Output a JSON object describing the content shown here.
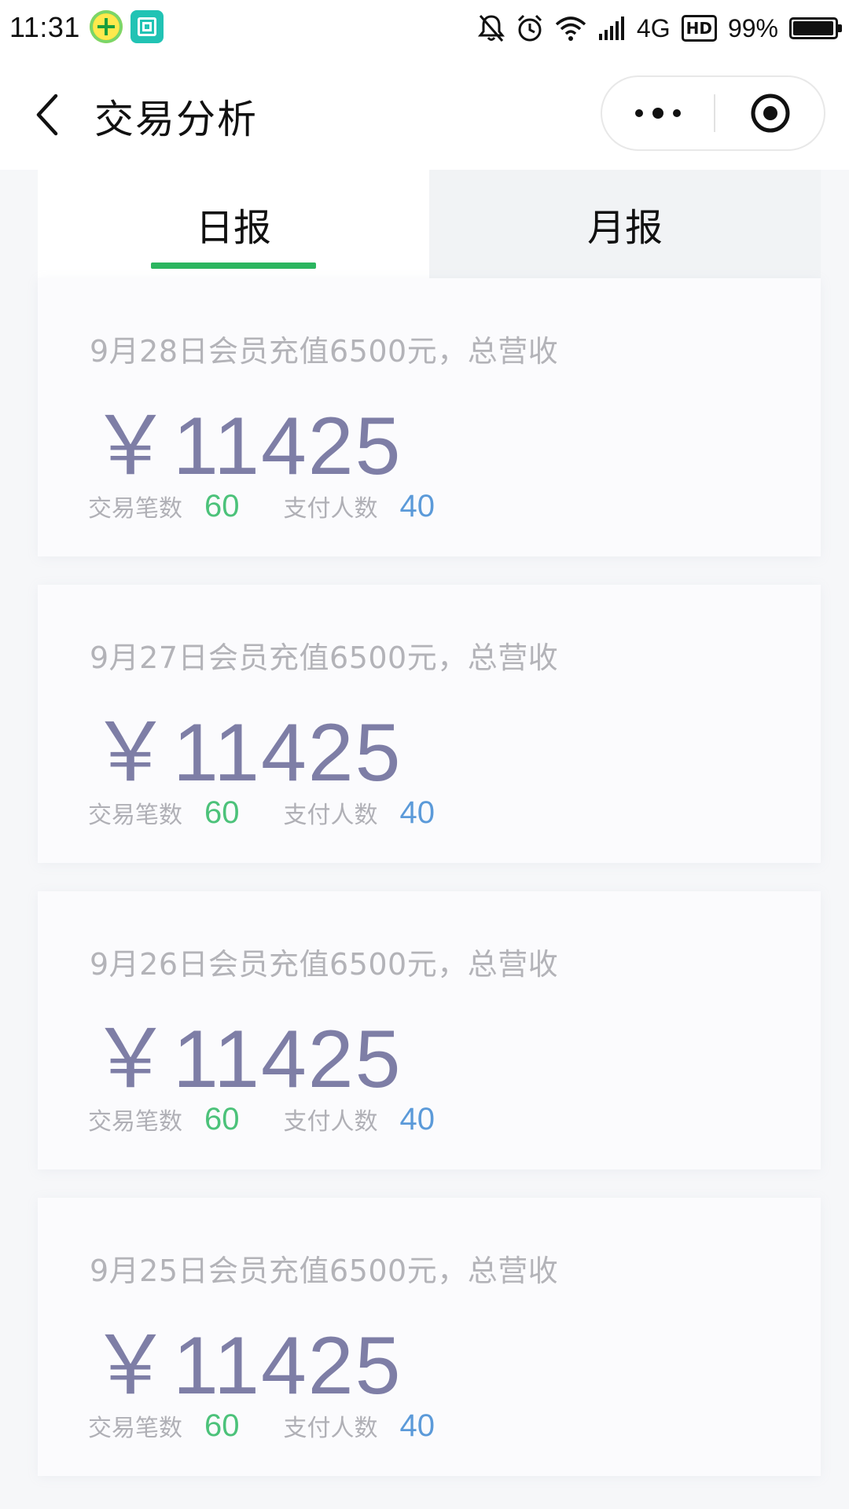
{
  "status_bar": {
    "time": "11:31",
    "network": "4G",
    "hd": "HD",
    "battery_percent": "99%",
    "battery_level": 0.99
  },
  "nav": {
    "title": "交易分析"
  },
  "tabs": [
    {
      "label": "日报",
      "active": true
    },
    {
      "label": "月报",
      "active": false
    }
  ],
  "colors": {
    "accent_green": "#2bb55f",
    "amount_color": "#7e7ea6",
    "trades_color": "#4cc27a",
    "payers_color": "#5b9ad9"
  },
  "reports": [
    {
      "description": "9月28日会员充值6500元，总营收",
      "amount": "￥11425",
      "trades_label": "交易笔数",
      "trades_value": "60",
      "payers_label": "支付人数",
      "payers_value": "40"
    },
    {
      "description": "9月27日会员充值6500元，总营收",
      "amount": "￥11425",
      "trades_label": "交易笔数",
      "trades_value": "60",
      "payers_label": "支付人数",
      "payers_value": "40"
    },
    {
      "description": "9月26日会员充值6500元，总营收",
      "amount": "￥11425",
      "trades_label": "交易笔数",
      "trades_value": "60",
      "payers_label": "支付人数",
      "payers_value": "40"
    },
    {
      "description": "9月25日会员充值6500元，总营收",
      "amount": "￥11425",
      "trades_label": "交易笔数",
      "trades_value": "60",
      "payers_label": "支付人数",
      "payers_value": "40"
    }
  ]
}
